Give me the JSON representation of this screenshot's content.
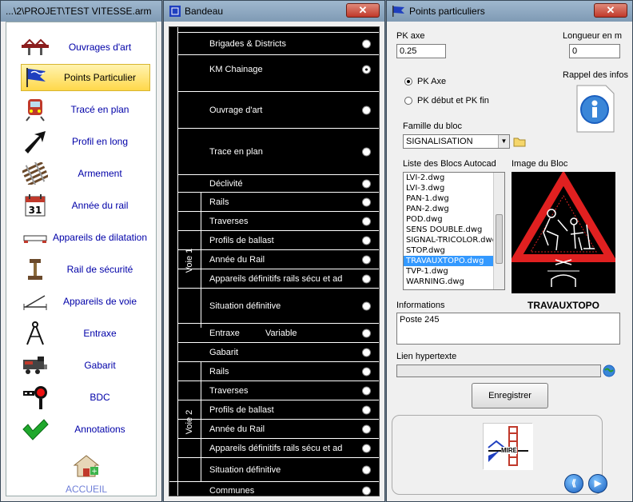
{
  "win1": {
    "title": "...\\2\\PROJET\\TEST VITESSE.arm",
    "items": [
      {
        "label": "Ouvrages d'art",
        "icon": "bridge-icon"
      },
      {
        "label": "Points Particulier",
        "icon": "flag-icon"
      },
      {
        "label": "Tracé en plan",
        "icon": "train-icon"
      },
      {
        "label": "Profil en long",
        "icon": "arrow-up-right-icon"
      },
      {
        "label": "Armement",
        "icon": "track-icon"
      },
      {
        "label": "Année du rail",
        "icon": "calendar-icon"
      },
      {
        "label": "Appareils de dilatation",
        "icon": "dilatation-icon"
      },
      {
        "label": "Rail de sécurité",
        "icon": "rail-icon"
      },
      {
        "label": "Appareils de voie",
        "icon": "switch-icon"
      },
      {
        "label": "Entraxe",
        "icon": "compass-icon"
      },
      {
        "label": "Gabarit",
        "icon": "locomotive-icon"
      },
      {
        "label": "BDC",
        "icon": "signal-icon"
      },
      {
        "label": "Annotations",
        "icon": "checkmark-icon"
      }
    ],
    "accueil": "ACCUEIL"
  },
  "win2": {
    "title": "Bandeau",
    "rows": {
      "r1": "Brigades & Districts",
      "r2": "KM Chainage",
      "r3": "Ouvrage d'art",
      "r4": "Trace en plan",
      "r5": "Déclivité",
      "v1a": "Rails",
      "v1b": "Traverses",
      "v1c": "Profils de ballast",
      "v1d": "Année du Rail",
      "v1e": "Appareils définitifs rails sécu et ad",
      "v1f": "Situation définitive",
      "entraxe": "Entraxe",
      "variable": "Variable",
      "gabarit": "Gabarit",
      "v2a": "Rails",
      "v2b": "Traverses",
      "v2c": "Profils de ballast",
      "v2d": "Année du Rail",
      "v2e": "Appareils définitifs rails sécu et ad",
      "v2f": "Situation définitive",
      "communes": "Communes"
    },
    "voie1": "Voie 1",
    "voie2": "Voie 2"
  },
  "win3": {
    "title": "Points particuliers",
    "pk_axe_label": "PK axe",
    "pk_axe_value": "0.25",
    "longueur_label": "Longueur en m",
    "longueur_value": "0",
    "radio_pk_axe": "PK Axe",
    "radio_pk_debut": "PK début et PK fin",
    "rappel": "Rappel des infos",
    "famille_label": "Famille du bloc",
    "famille_value": "SIGNALISATION",
    "liste_label": "Liste des Blocs Autocad",
    "image_label": "Image du Bloc",
    "blocks": [
      "LVI-2.dwg",
      "LVI-3.dwg",
      "PAN-1.dwg",
      "PAN-2.dwg",
      "POD.dwg",
      "SENS DOUBLE.dwg",
      "SIGNAL-TRICOLOR.dwg",
      "STOP.dwg",
      "TRAVAUXTOPO.dwg",
      "TVP-1.dwg",
      "WARNING.dwg"
    ],
    "informations_label": "Informations",
    "block_name": "TRAVAUXTOPO",
    "informations_value": "Poste 245",
    "lien_label": "Lien hypertexte",
    "lien_value": "",
    "save_label": "Enregistrer",
    "logo_text": "MIRE"
  },
  "colors": {
    "accent": "#3399ff",
    "title_bar": "#8aa5be",
    "selected_item": "#ffd84a"
  }
}
